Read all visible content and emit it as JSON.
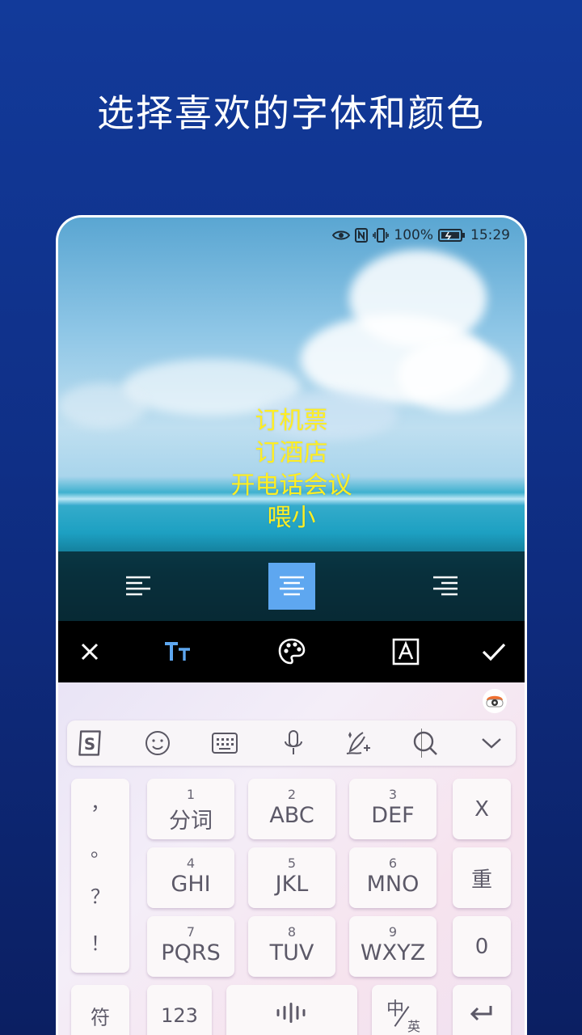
{
  "headline": "选择喜欢的字体和颜色",
  "status_bar": {
    "battery": "100%",
    "time": "15:29",
    "icons": [
      "eye-icon",
      "nfc-icon",
      "vibrate-icon",
      "battery-icon"
    ]
  },
  "overlay_text": {
    "lines": [
      "订机票",
      "订酒店",
      "开电话会议",
      "喂小"
    ],
    "color": "#ffee22"
  },
  "alignment": {
    "options": [
      "align-left",
      "align-center",
      "align-right"
    ],
    "selected": "align-center"
  },
  "toolbar": {
    "icons": [
      "close-icon",
      "text-size-icon",
      "palette-icon",
      "font-style-icon",
      "check-icon"
    ],
    "active": "text-size-icon",
    "active_color": "#5ea7f0"
  },
  "keyboard": {
    "candidate_bar_icons": [
      "sogou-logo-icon",
      "emoji-icon",
      "keyboard-icon",
      "microphone-icon",
      "handwriting-icon",
      "search-icon",
      "chevron-down-icon"
    ],
    "punctuation": [
      "，",
      "。",
      "？",
      "！"
    ],
    "keys": [
      {
        "num": "1",
        "label": "分词"
      },
      {
        "num": "2",
        "label": "ABC"
      },
      {
        "num": "3",
        "label": "DEF"
      },
      {
        "num": "4",
        "label": "GHI"
      },
      {
        "num": "5",
        "label": "JKL"
      },
      {
        "num": "6",
        "label": "MNO"
      },
      {
        "num": "7",
        "label": "PQRS"
      },
      {
        "num": "8",
        "label": "TUV"
      },
      {
        "num": "9",
        "label": "WXYZ"
      }
    ],
    "right_keys": [
      "X",
      "重",
      "0"
    ],
    "bottom": {
      "symbols": "符",
      "numbers": "123",
      "lang_top": "中",
      "lang_bottom": "英"
    }
  }
}
